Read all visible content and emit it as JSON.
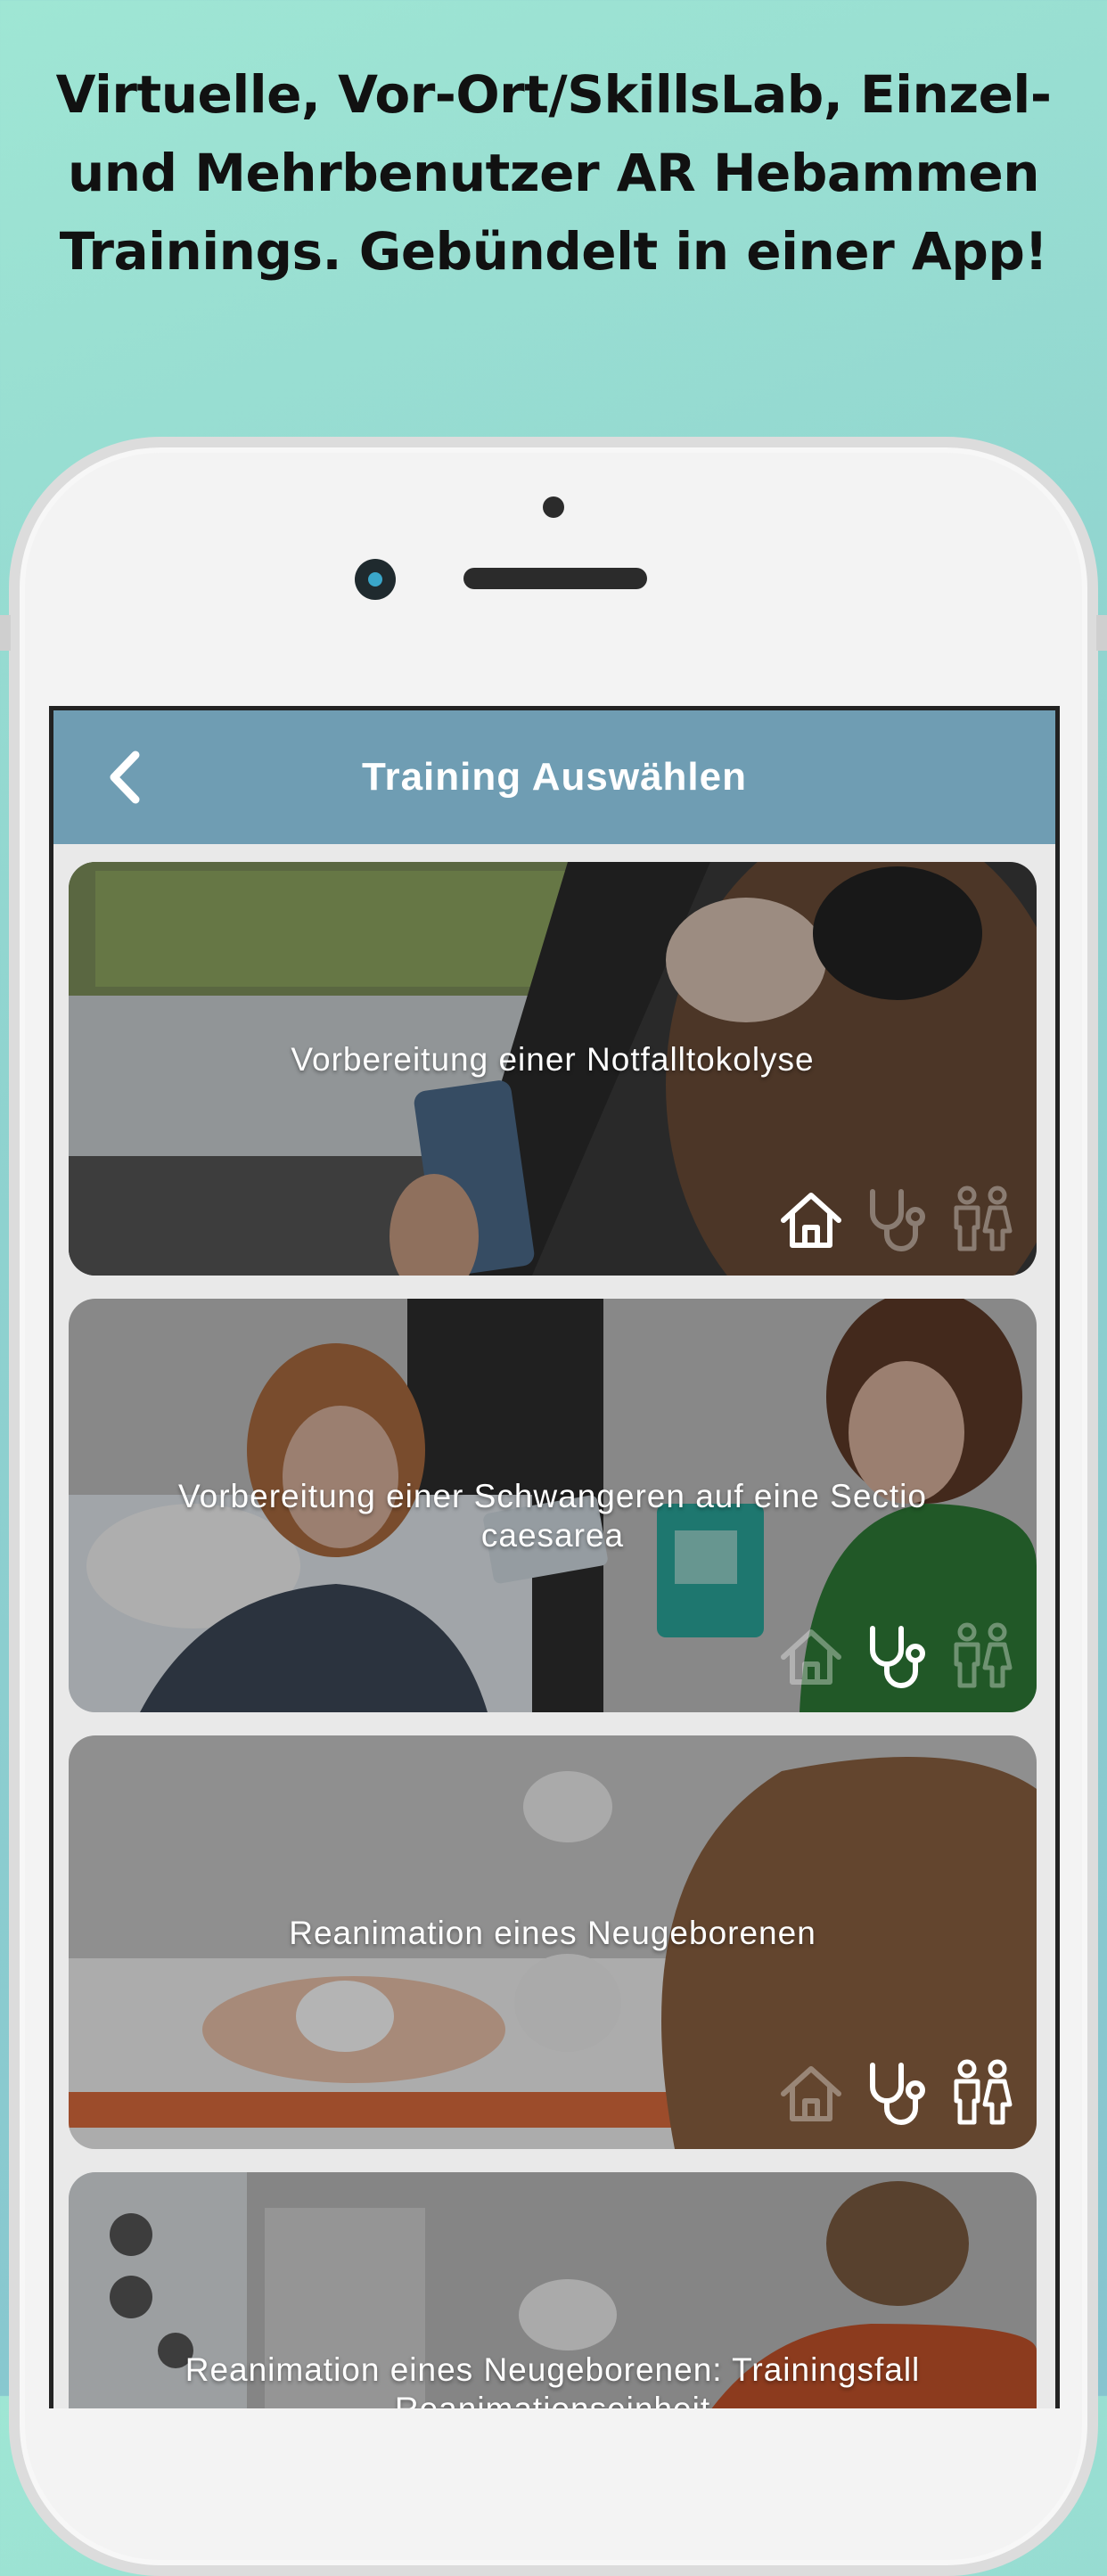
{
  "promo": {
    "headline_line1": "Virtuelle, Vor-Ort/SkillsLab, Einzel-",
    "headline_line2": "und Mehrbenutzer AR Hebammen",
    "headline_line3": "Trainings. Gebündelt in einer App!"
  },
  "appbar": {
    "title": "Training Auswählen",
    "back_icon": "chevron-left-icon"
  },
  "trainings": [
    {
      "title": "Vorbereitung einer Notfalltokolyse",
      "home_active": true,
      "clinic_active": false,
      "multiuser_active": false
    },
    {
      "title": "Vorbereitung einer Schwangeren auf eine Sectio caesarea",
      "home_active": false,
      "clinic_active": true,
      "multiuser_active": false
    },
    {
      "title": "Reanimation eines Neugeborenen",
      "home_active": false,
      "clinic_active": true,
      "multiuser_active": true
    },
    {
      "title": "Reanimation eines Neugeborenen: Trainingsfall Reanimationseinheit"
    }
  ],
  "mode_icons": [
    "home-icon",
    "stethoscope-icon",
    "multiuser-icon"
  ],
  "colors": {
    "appbar": "#6f9db3",
    "background_top": "#9fe6d4",
    "background_bottom": "#86c4cf"
  }
}
